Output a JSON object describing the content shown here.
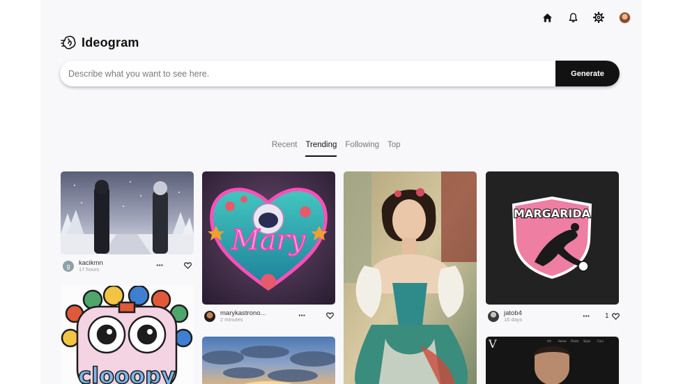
{
  "app": {
    "name": "Ideogram"
  },
  "header": {
    "icons": [
      "home-icon",
      "bell-icon",
      "gear-icon",
      "avatar"
    ]
  },
  "search": {
    "placeholder": "Describe what you want to see here.",
    "button_label": "Generate"
  },
  "tabs": [
    {
      "label": "Recent",
      "active": false
    },
    {
      "label": "Trending",
      "active": true
    },
    {
      "label": "Following",
      "active": false
    },
    {
      "label": "Top",
      "active": false
    }
  ],
  "cards": [
    {
      "user": "kacikmn",
      "avatar_letter": "g",
      "time": "17 hours",
      "likes": ""
    },
    {
      "user": "marykastrono...",
      "time": "2 minutes",
      "likes": ""
    },
    {
      "user": "",
      "time": "",
      "likes": ""
    },
    {
      "user": "jatob4",
      "time": "16 days",
      "likes": "1"
    }
  ],
  "images": {
    "mary_text": "Mary",
    "margarida_text": "MARGARIDA",
    "loopy_text": "clooopy",
    "magazine_letter": "V",
    "magazine_nav": [
      "Art",
      "Home",
      "Photo",
      "Style",
      "Cars"
    ]
  },
  "colors": {
    "accent": "#121212",
    "background": "#f8f8fa"
  }
}
